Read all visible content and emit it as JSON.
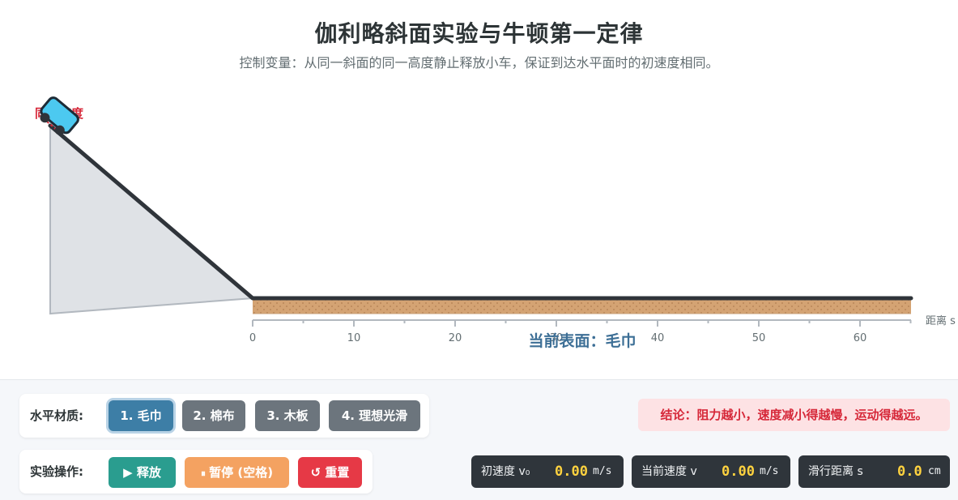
{
  "header": {
    "title": "伽利略斜面实验与牛顿第一定律",
    "subtitle": "控制变量：从同一斜面的同一高度静止释放小车，保证到达水平面时的初速度相同。"
  },
  "scene": {
    "release_marker": "同一高度",
    "axis_label": "距离 s",
    "ticks": [
      "0",
      "10",
      "20",
      "30",
      "40",
      "50",
      "60"
    ],
    "surface_label": "当前表面：毛巾",
    "colors": {
      "track": "#2f343a",
      "ramp_fill": "#dfe2e6",
      "towel": "#d4a373",
      "cart": "#4cc9f0"
    }
  },
  "materials": {
    "label": "水平材质:",
    "options": [
      "1. 毛巾",
      "2. 棉布",
      "3. 木板",
      "4. 理想光滑"
    ],
    "selected": "1. 毛巾"
  },
  "controls": {
    "label": "实验操作:",
    "release": "释放",
    "pause": "暂停 (空格)",
    "reset": "重置",
    "release_icon": "play-icon",
    "pause_icon": "pause-icon",
    "reset_icon": "reset-icon"
  },
  "conclusion": "结论：阻力越小，速度减小得越慢，运动得越远。",
  "meters": [
    {
      "label": "初速度 v₀",
      "value": "0.00",
      "unit": "m/s"
    },
    {
      "label": "当前速度 v",
      "value": "0.00",
      "unit": "m/s"
    },
    {
      "label": "滑行距离 s",
      "value": "0.0",
      "unit": "cm"
    }
  ]
}
